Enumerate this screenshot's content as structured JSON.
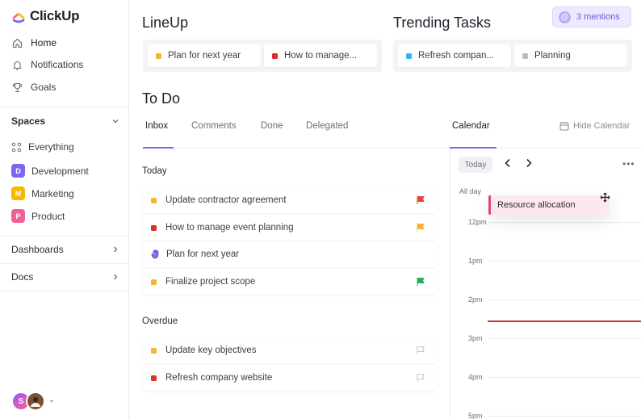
{
  "app": {
    "name": "ClickUp"
  },
  "sidebar": {
    "nav": [
      {
        "label": "Home",
        "icon": "home-icon"
      },
      {
        "label": "Notifications",
        "icon": "bell-icon"
      },
      {
        "label": "Goals",
        "icon": "trophy-icon"
      }
    ],
    "spaces_label": "Spaces",
    "spaces": [
      {
        "label": "Everything",
        "badge": "",
        "color": ""
      },
      {
        "label": "Development",
        "badge": "D",
        "color": "#7b68ee"
      },
      {
        "label": "Marketing",
        "badge": "M",
        "color": "#f5b800"
      },
      {
        "label": "Product",
        "badge": "P",
        "color": "#f2609a"
      }
    ],
    "dashboards_label": "Dashboards",
    "docs_label": "Docs",
    "user_initial": "S"
  },
  "lineup": {
    "title": "LineUp",
    "items": [
      {
        "label": "Plan for next year",
        "color": "#f5b436"
      },
      {
        "label": "How to manage...",
        "color": "#d8312a"
      }
    ]
  },
  "trending": {
    "title": "Trending Tasks",
    "items": [
      {
        "label": "Refresh compan...",
        "color": "#2fb8e8"
      },
      {
        "label": "Planning",
        "color": "#b9bcc2"
      }
    ]
  },
  "mentions": {
    "label": "3 mentions",
    "icon_symbol": "@"
  },
  "todo": {
    "title": "To Do",
    "tabs": [
      "Inbox",
      "Comments",
      "Done",
      "Delegated"
    ],
    "active_tab": "Inbox",
    "groups": [
      {
        "title": "Today",
        "tasks": [
          {
            "label": "Update contractor agreement",
            "status_color": "#f5b436",
            "flag": "red"
          },
          {
            "label": "How to manage event planning",
            "status_color": "#d8312a",
            "flag": "yellow"
          },
          {
            "label": "Plan for next year",
            "status_color": "",
            "flag": ""
          },
          {
            "label": "Finalize project scope",
            "status_color": "#f5b436",
            "flag": "green"
          }
        ]
      },
      {
        "title": "Overdue",
        "tasks": [
          {
            "label": "Update key objectives",
            "status_color": "#f5b436",
            "flag": "empty"
          },
          {
            "label": "Refresh company website",
            "status_color": "#d8312a",
            "flag": "empty"
          }
        ]
      }
    ]
  },
  "calendar": {
    "title": "Calendar",
    "hide_label": "Hide Calendar",
    "today_label": "Today",
    "more_label": "•••",
    "all_day_label": "All day",
    "hours": [
      "12pm",
      "1pm",
      "2pm",
      "3pm",
      "4pm",
      "5pm"
    ],
    "event": {
      "label": "Resource allocation"
    }
  },
  "colors": {
    "accent": "#7b68ee",
    "now_line": "#d2322d",
    "event_border": "#e0457b"
  }
}
